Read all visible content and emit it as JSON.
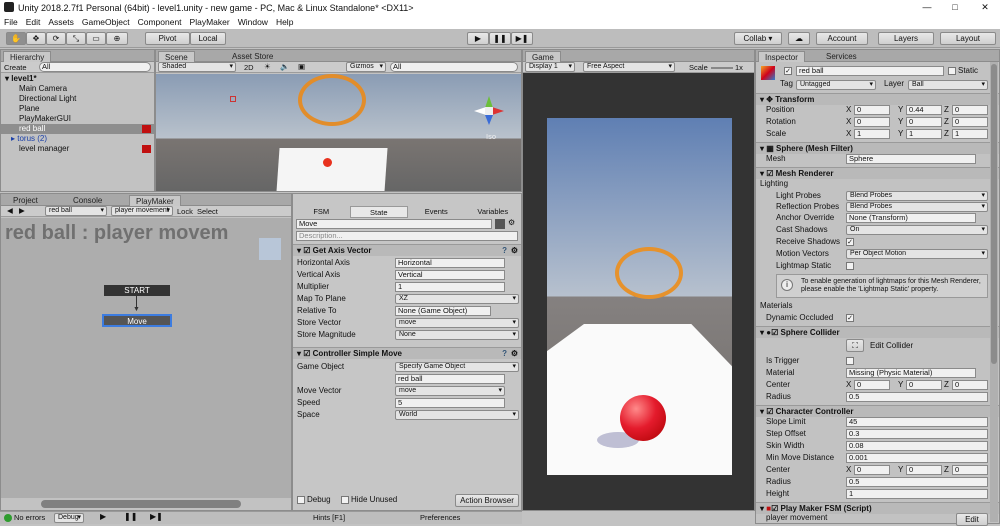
{
  "window": {
    "title": "Unity 2018.2.7f1 Personal (64bit) - level1.unity - new game - PC, Mac & Linux Standalone* <DX11>",
    "minimize": "—",
    "maximize": "□",
    "close": "✕"
  },
  "menu": [
    "File",
    "Edit",
    "Assets",
    "GameObject",
    "Component",
    "PlayMaker",
    "Window",
    "Help"
  ],
  "toolbar": {
    "pivot": "Pivot",
    "local": "Local",
    "collab": "Collab ▾",
    "account": "Account",
    "layers": "Layers",
    "layout": "Layout"
  },
  "hierarchy": {
    "tab": "Hierarchy",
    "create": "Create",
    "search_placeholder": "All",
    "scene": "level1*",
    "items": [
      "Main Camera",
      "Directional Light",
      "Plane",
      "PlayMakerGUI",
      "red ball",
      "torus (2)",
      "level manager"
    ]
  },
  "scene": {
    "tab": "Scene",
    "asset_tab": "Asset Store",
    "shading": "Shaded",
    "mode2d": "2D",
    "gizmos": "Gizmos",
    "search_placeholder": "All",
    "iso": "Iso"
  },
  "game": {
    "tab": "Game",
    "display": "Display 1",
    "aspect": "Free Aspect",
    "scale_label": "Scale",
    "scale_value": "1x"
  },
  "bottom_tabs": {
    "project": "Project",
    "console": "Console",
    "playmaker": "PlayMaker"
  },
  "playmaker": {
    "object": "red ball",
    "fsm": "player movement",
    "lock": "Lock",
    "select": "Select",
    "graph_title": "red ball : player movem",
    "start": "START",
    "state": "Move",
    "hints": "Hints [F1]",
    "preferences": "Preferences"
  },
  "fsm_inspector": {
    "tabs": [
      "FSM",
      "State",
      "Events",
      "Variables"
    ],
    "state_name": "Move",
    "description_placeholder": "Description...",
    "get_axis": {
      "title": "Get Axis Vector",
      "rows": [
        [
          "Horizontal Axis",
          "Horizontal"
        ],
        [
          "Vertical Axis",
          "Vertical"
        ],
        [
          "Multiplier",
          "1"
        ],
        [
          "Map To Plane",
          "XZ"
        ],
        [
          "Relative To",
          "None (Game Object)"
        ],
        [
          "Store Vector",
          "move"
        ],
        [
          "Store Magnitude",
          "None"
        ]
      ]
    },
    "controller": {
      "title": "Controller Simple Move",
      "rows": [
        [
          "Game Object",
          "Specify Game Object"
        ],
        [
          "",
          "red ball"
        ],
        [
          "Move Vector",
          "move"
        ],
        [
          "Speed",
          "5"
        ],
        [
          "Space",
          "World"
        ]
      ]
    },
    "debug": "Debug",
    "hide_unused": "Hide Unused",
    "action_browser": "Action Browser"
  },
  "inspector": {
    "tab": "Inspector",
    "services_tab": "Services",
    "name": "red ball",
    "static": "Static",
    "tag_label": "Tag",
    "tag": "Untagged",
    "layer_label": "Layer",
    "layer": "Ball",
    "transform": {
      "title": "Transform",
      "position": [
        "Position",
        "0",
        "0.44",
        "0"
      ],
      "rotation": [
        "Rotation",
        "0",
        "0",
        "0"
      ],
      "scale": [
        "Scale",
        "1",
        "1",
        "1"
      ]
    },
    "mesh_filter": {
      "title": "Sphere (Mesh Filter)",
      "mesh_label": "Mesh",
      "mesh": "Sphere"
    },
    "mesh_renderer": {
      "title": "Mesh Renderer",
      "lighting": "Lighting",
      "rows": [
        [
          "Light Probes",
          "Blend Probes"
        ],
        [
          "Reflection Probes",
          "Blend Probes"
        ],
        [
          "Anchor Override",
          "None (Transform)"
        ],
        [
          "Cast Shadows",
          "On"
        ],
        [
          "Receive Shadows",
          ""
        ],
        [
          "Motion Vectors",
          "Per Object Motion"
        ],
        [
          "Lightmap Static",
          ""
        ]
      ],
      "info": "To enable generation of lightmaps for this Mesh Renderer, please enable the 'Lightmap Static' property.",
      "materials": "Materials",
      "dynamic_occluded": "Dynamic Occluded"
    },
    "sphere_collider": {
      "title": "Sphere Collider",
      "edit": "Edit Collider",
      "is_trigger": "Is Trigger",
      "material_label": "Material",
      "material": "Missing (Physic Material)",
      "center": [
        "Center",
        "0",
        "0",
        "0"
      ],
      "radius_label": "Radius",
      "radius": "0.5"
    },
    "character_controller": {
      "title": "Character Controller",
      "rows": [
        [
          "Slope Limit",
          "45"
        ],
        [
          "Step Offset",
          "0.3"
        ],
        [
          "Skin Width",
          "0.08"
        ],
        [
          "Min Move Distance",
          "0.001"
        ]
      ],
      "center": [
        "Center",
        "0",
        "0",
        "0"
      ],
      "radius": [
        "Radius",
        "0.5"
      ],
      "height": [
        "Height",
        "1"
      ]
    },
    "playmaker_fsm": {
      "title": "Play Maker FSM (Script)",
      "fsm": "player movement",
      "edit": "Edit"
    }
  },
  "status": {
    "errors": "No errors",
    "debug": "Debug"
  }
}
